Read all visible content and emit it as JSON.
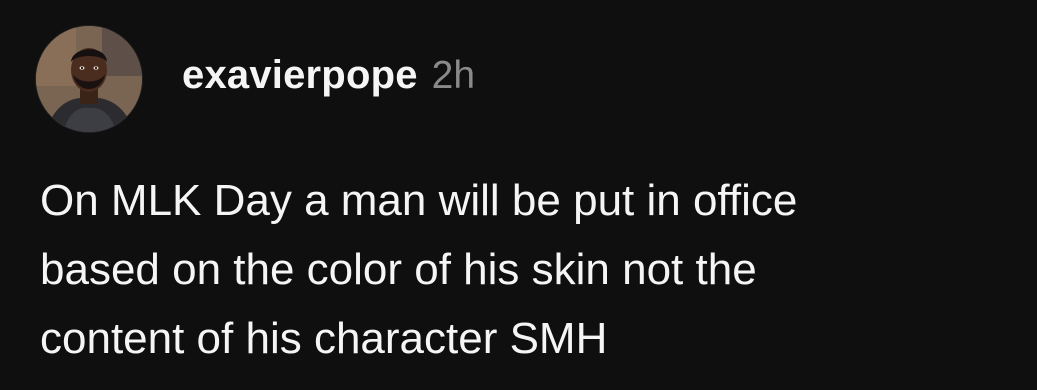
{
  "post": {
    "author": {
      "username": "exavierpope",
      "avatar_icon": "profile-photo-icon"
    },
    "timestamp": "2h",
    "text_lines": [
      "On MLK Day a man will be put in office",
      "based on the color of his skin not the",
      "content of his character SMH"
    ]
  },
  "colors": {
    "background": "#0f0f0f",
    "primary_text": "#f5f5f5",
    "secondary_text": "#8a8a8a"
  }
}
